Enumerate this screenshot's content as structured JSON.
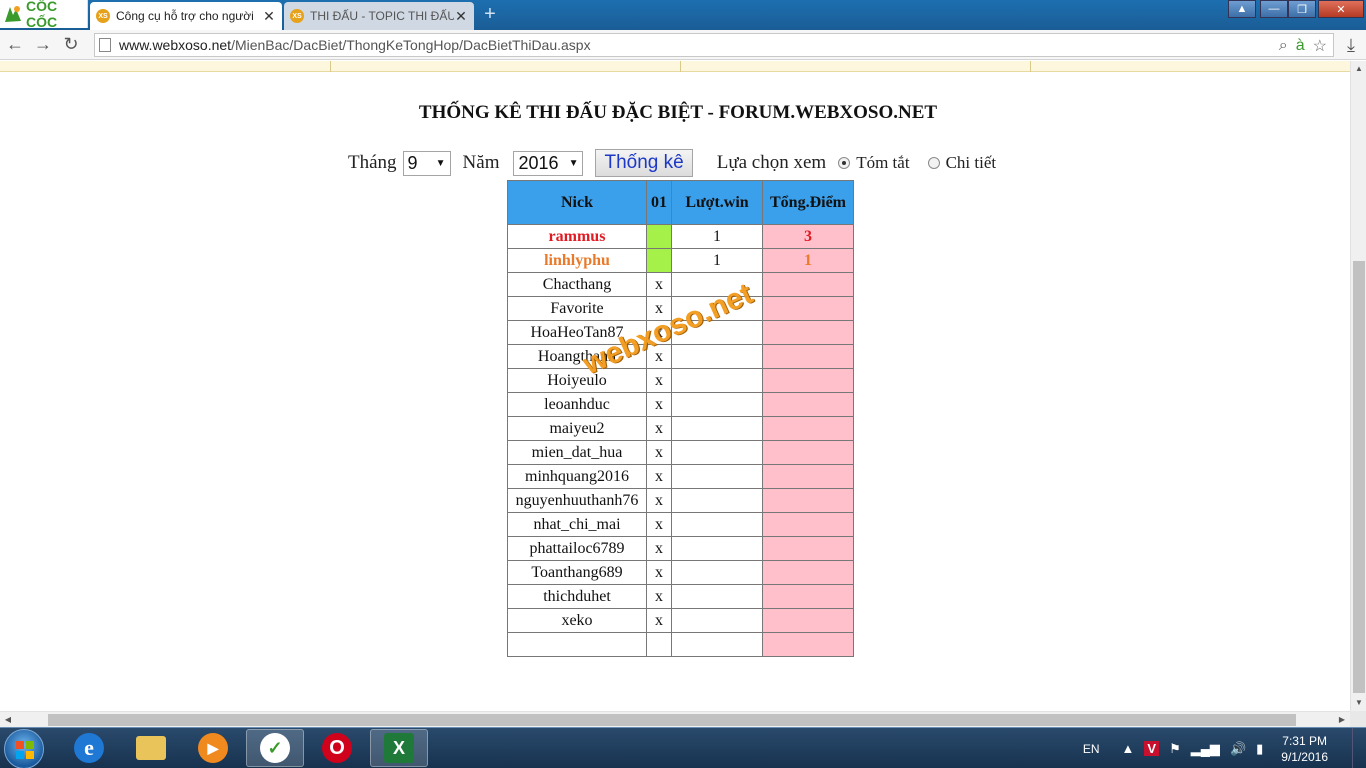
{
  "browser": {
    "brand": "CỐC CỐC",
    "tabs": [
      {
        "favicon": "XS",
        "title": "Công cụ hỗ trợ cho người",
        "active": true
      },
      {
        "favicon": "XS",
        "title": "THI ĐẤU - TOPIC THI ĐẤU",
        "active": false
      }
    ],
    "new_tab_icon": "+",
    "url_host": "www.webxoso.net",
    "url_path": "/MienBac/DacBiet/ThongKeTongHop/DacBietThiDau.aspx"
  },
  "page": {
    "title": "THỐNG KÊ THI ĐẤU ĐẶC BIỆT - FORUM.WEBXOSO.NET",
    "filters": {
      "month_label": "Tháng",
      "month_value": "9",
      "year_label": "Năm",
      "year_value": "2016",
      "submit_label": "Thống kê",
      "view_label": "Lựa chọn xem",
      "view_options": [
        "Tóm tắt",
        "Chi tiết"
      ],
      "view_selected": "Tóm tắt"
    },
    "table": {
      "headers": [
        "Nick",
        "01",
        "Lượt.win",
        "Tổng.Điểm"
      ],
      "rows": [
        {
          "nick": "rammus",
          "day01": "",
          "wins": "1",
          "points": "3",
          "highlight": "red"
        },
        {
          "nick": "linhlyphu",
          "day01": "",
          "wins": "1",
          "points": "1",
          "highlight": "orange"
        },
        {
          "nick": "Chacthang",
          "day01": "x",
          "wins": "",
          "points": ""
        },
        {
          "nick": "Favorite",
          "day01": "x",
          "wins": "",
          "points": ""
        },
        {
          "nick": "HoaHeoTan87",
          "day01": "x",
          "wins": "",
          "points": ""
        },
        {
          "nick": "Hoangthanh",
          "day01": "x",
          "wins": "",
          "points": ""
        },
        {
          "nick": "Hoiyeulo",
          "day01": "x",
          "wins": "",
          "points": ""
        },
        {
          "nick": "leoanhduc",
          "day01": "x",
          "wins": "",
          "points": ""
        },
        {
          "nick": "maiyeu2",
          "day01": "x",
          "wins": "",
          "points": ""
        },
        {
          "nick": "mien_dat_hua",
          "day01": "x",
          "wins": "",
          "points": ""
        },
        {
          "nick": "minhquang2016",
          "day01": "x",
          "wins": "",
          "points": ""
        },
        {
          "nick": "nguyenhuuthanh76",
          "day01": "x",
          "wins": "",
          "points": ""
        },
        {
          "nick": "nhat_chi_mai",
          "day01": "x",
          "wins": "",
          "points": ""
        },
        {
          "nick": "phattailoc6789",
          "day01": "x",
          "wins": "",
          "points": ""
        },
        {
          "nick": "Toanthang689",
          "day01": "x",
          "wins": "",
          "points": ""
        },
        {
          "nick": "thichduhet",
          "day01": "x",
          "wins": "",
          "points": ""
        },
        {
          "nick": "xeko",
          "day01": "x",
          "wins": "",
          "points": ""
        },
        {
          "nick": "",
          "day01": "",
          "wins": "",
          "points": ""
        }
      ]
    },
    "watermark": "webxoso.net"
  },
  "colors": {
    "header_bg": "#3aa0ec",
    "points_bg": "#ffc0cb",
    "day_win_bg": "#a6f04a",
    "red": "#e01b24",
    "orange": "#e87a2a"
  },
  "taskbar": {
    "apps": [
      "internet-explorer-icon",
      "file-explorer-icon",
      "media-player-icon",
      "coccoc-browser-icon",
      "opera-icon",
      "excel-icon"
    ],
    "language": "EN",
    "time": "7:31 PM",
    "date": "9/1/2016"
  }
}
